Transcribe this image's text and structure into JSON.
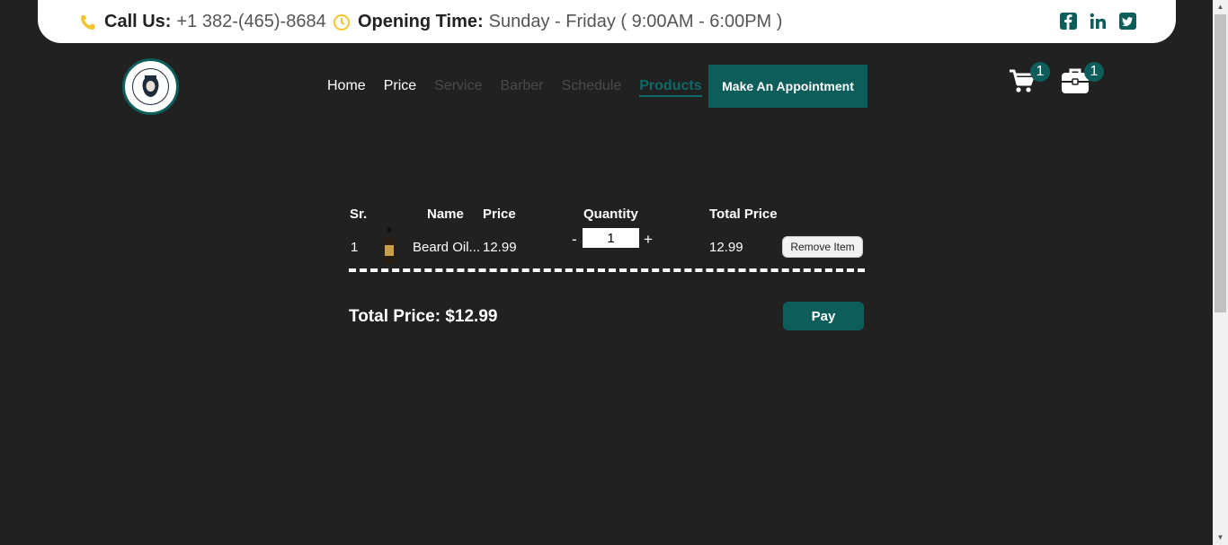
{
  "topbar": {
    "call_label": "Call Us:",
    "call_value": "+1 382-(465)-8684",
    "hours_label": "Opening Time:",
    "hours_value": "Sunday - Friday ( 9:00AM - 6:00PM )",
    "social_icons": [
      "facebook-icon",
      "linkedin-icon",
      "twitter-icon"
    ]
  },
  "nav": {
    "items": [
      "Home",
      "Price",
      "Service",
      "Barber",
      "Schedule",
      "Products"
    ],
    "active": "Products",
    "appointment_label": "Make An Appointment",
    "cart_count": "1",
    "bag_count": "1"
  },
  "cart_table": {
    "headers": [
      "Sr.",
      "Name",
      "Price",
      "Quantity",
      "Total Price"
    ],
    "rows": [
      {
        "sr": "1",
        "name": "Beard Oil...",
        "price": "12.99",
        "quantity": "1",
        "total": "12.99",
        "remove_label": "Remove Item"
      }
    ],
    "minus": "-",
    "plus": "+"
  },
  "summary": {
    "total_text": "Total Price: $12.99",
    "pay_label": "Pay"
  },
  "colors": {
    "background": "#212121",
    "accent": "#0d5e5a",
    "icon_yellow": "#f4c430"
  }
}
